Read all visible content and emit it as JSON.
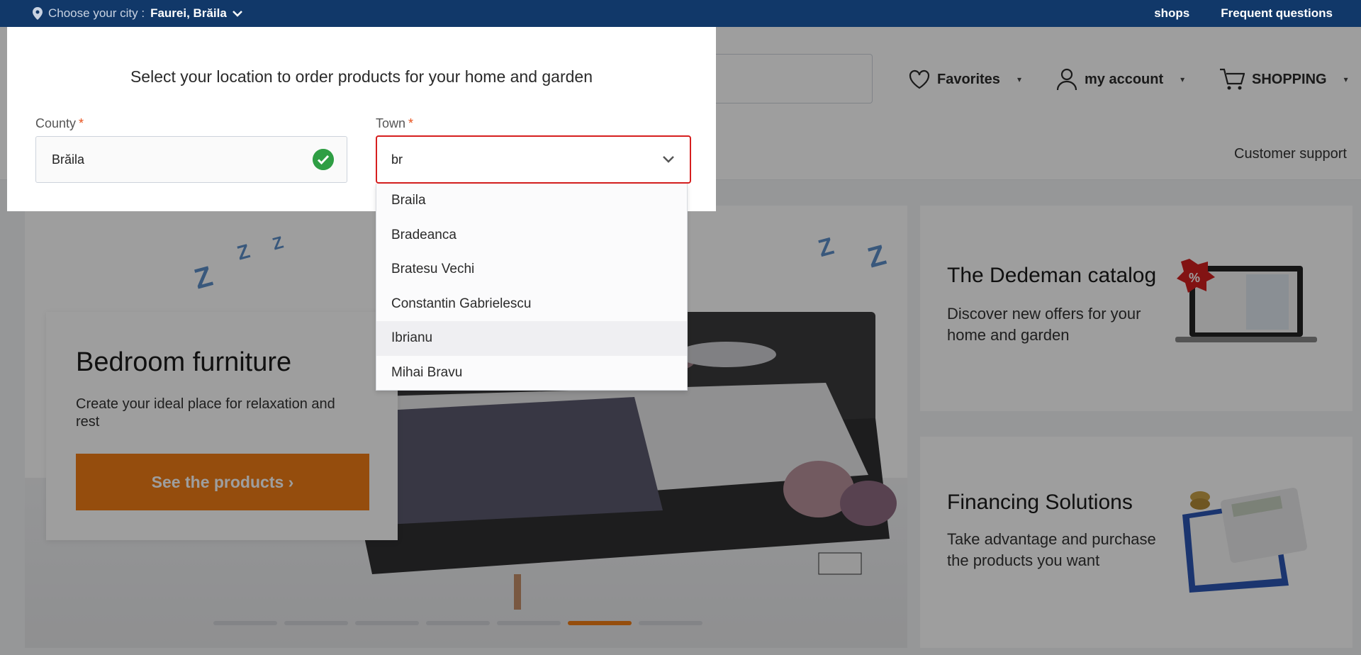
{
  "topbar": {
    "city_prefix": "Choose your city :",
    "city_value": "Faurei, Brăila",
    "links": [
      "shops",
      "Frequent questions"
    ]
  },
  "header": {
    "favorites": "Favorites",
    "account": "my account",
    "shopping": "SHOPPING",
    "support": "Customer support"
  },
  "hero": {
    "title": "Bedroom furniture",
    "subtitle": "Create your ideal place for relaxation and rest",
    "cta": "See the products ›",
    "active_slide": 6,
    "slide_count": 7
  },
  "side_cards": [
    {
      "title": "The Dedeman catalog",
      "text": "Discover new offers for your home and garden"
    },
    {
      "title": "Financing Solutions",
      "text": "Take advantage and purchase the products you want"
    }
  ],
  "modal": {
    "title": "Select your location to order products for your home and garden",
    "county_label": "County",
    "county_value": "Brăila",
    "town_label": "Town",
    "town_value": "br",
    "required_mark": "*",
    "options": [
      "Braila",
      "Bradeanca",
      "Bratesu Vechi",
      "Constantin Gabrielescu",
      "Ibrianu",
      "Mihai Bravu"
    ],
    "hovered_option": "Ibrianu"
  },
  "colors": {
    "topbar": "#113869",
    "accent": "#f07d16",
    "error_border": "#d61f1f",
    "success": "#2f9e44"
  }
}
